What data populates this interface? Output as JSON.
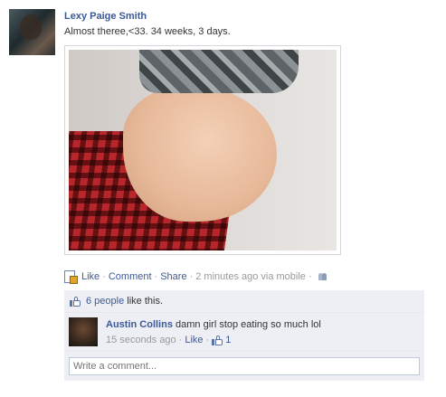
{
  "post": {
    "author": "Lexy Paige Smith",
    "status": "Almost theree,<33. 34 weeks, 3 days.",
    "actions": {
      "like": "Like",
      "comment": "Comment",
      "share": "Share",
      "separator": "·",
      "time": "2 minutes ago via mobile"
    }
  },
  "likes": {
    "people_link": "6 people",
    "suffix": " like this."
  },
  "comment": {
    "author": "Austin Collins",
    "text": "damn girl stop eating so much lol",
    "time": "15 seconds ago",
    "like": "Like",
    "like_count": "1"
  },
  "write_comment": {
    "placeholder": "Write a comment..."
  },
  "colors": {
    "link": "#3b5998",
    "ufi_background": "#edeff4",
    "meta_text": "#999999"
  }
}
